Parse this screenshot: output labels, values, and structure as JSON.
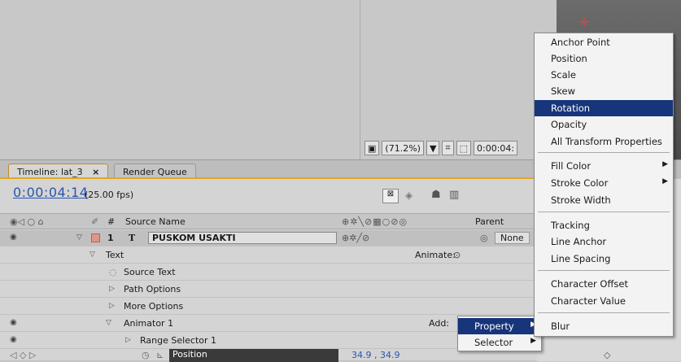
{
  "viewer": {
    "zoom": "(71.2%)",
    "timecode": "0:00:04:"
  },
  "tabs": {
    "timeline": "Timeline: lat_3",
    "render_queue": "Render Queue",
    "close": "×"
  },
  "timeline": {
    "timecode": "0:00:04:14",
    "fps": "(25.00 fps)"
  },
  "header": {
    "hash": "#",
    "source_name": "Source Name",
    "parent": "Parent"
  },
  "layer": {
    "number": "1",
    "type_glyph": "T",
    "name": "PUSKOM USAKTI",
    "parent_value": "None"
  },
  "rows": {
    "text": "Text",
    "animate_label": "Animate:",
    "source_text": "Source Text",
    "path_options": "Path Options",
    "more_options": "More Options",
    "animator": "Animator 1",
    "add_label": "Add:",
    "range_selector": "Range Selector 1",
    "position": "Position",
    "position_value": "34.9 , 34.9"
  },
  "add_menu": [
    {
      "label": "Property",
      "selected": true,
      "submenu": true
    },
    {
      "label": "Selector",
      "selected": false,
      "submenu": true
    }
  ],
  "property_menu": [
    {
      "label": "Anchor Point"
    },
    {
      "label": "Position"
    },
    {
      "label": "Scale"
    },
    {
      "label": "Skew"
    },
    {
      "label": "Rotation",
      "selected": true
    },
    {
      "label": "Opacity"
    },
    {
      "label": "All Transform Properties"
    },
    {
      "label": "Fill Color",
      "submenu": true
    },
    {
      "label": "Stroke Color",
      "submenu": true
    },
    {
      "label": "Stroke Width"
    },
    {
      "label": "Tracking"
    },
    {
      "label": "Line Anchor"
    },
    {
      "label": "Line Spacing"
    },
    {
      "label": "Character Offset"
    },
    {
      "label": "Character Value"
    },
    {
      "label": "Blur"
    }
  ],
  "colors": {
    "accent": "#e0a820",
    "selection": "#17357a",
    "timecode": "#2a55b0"
  }
}
